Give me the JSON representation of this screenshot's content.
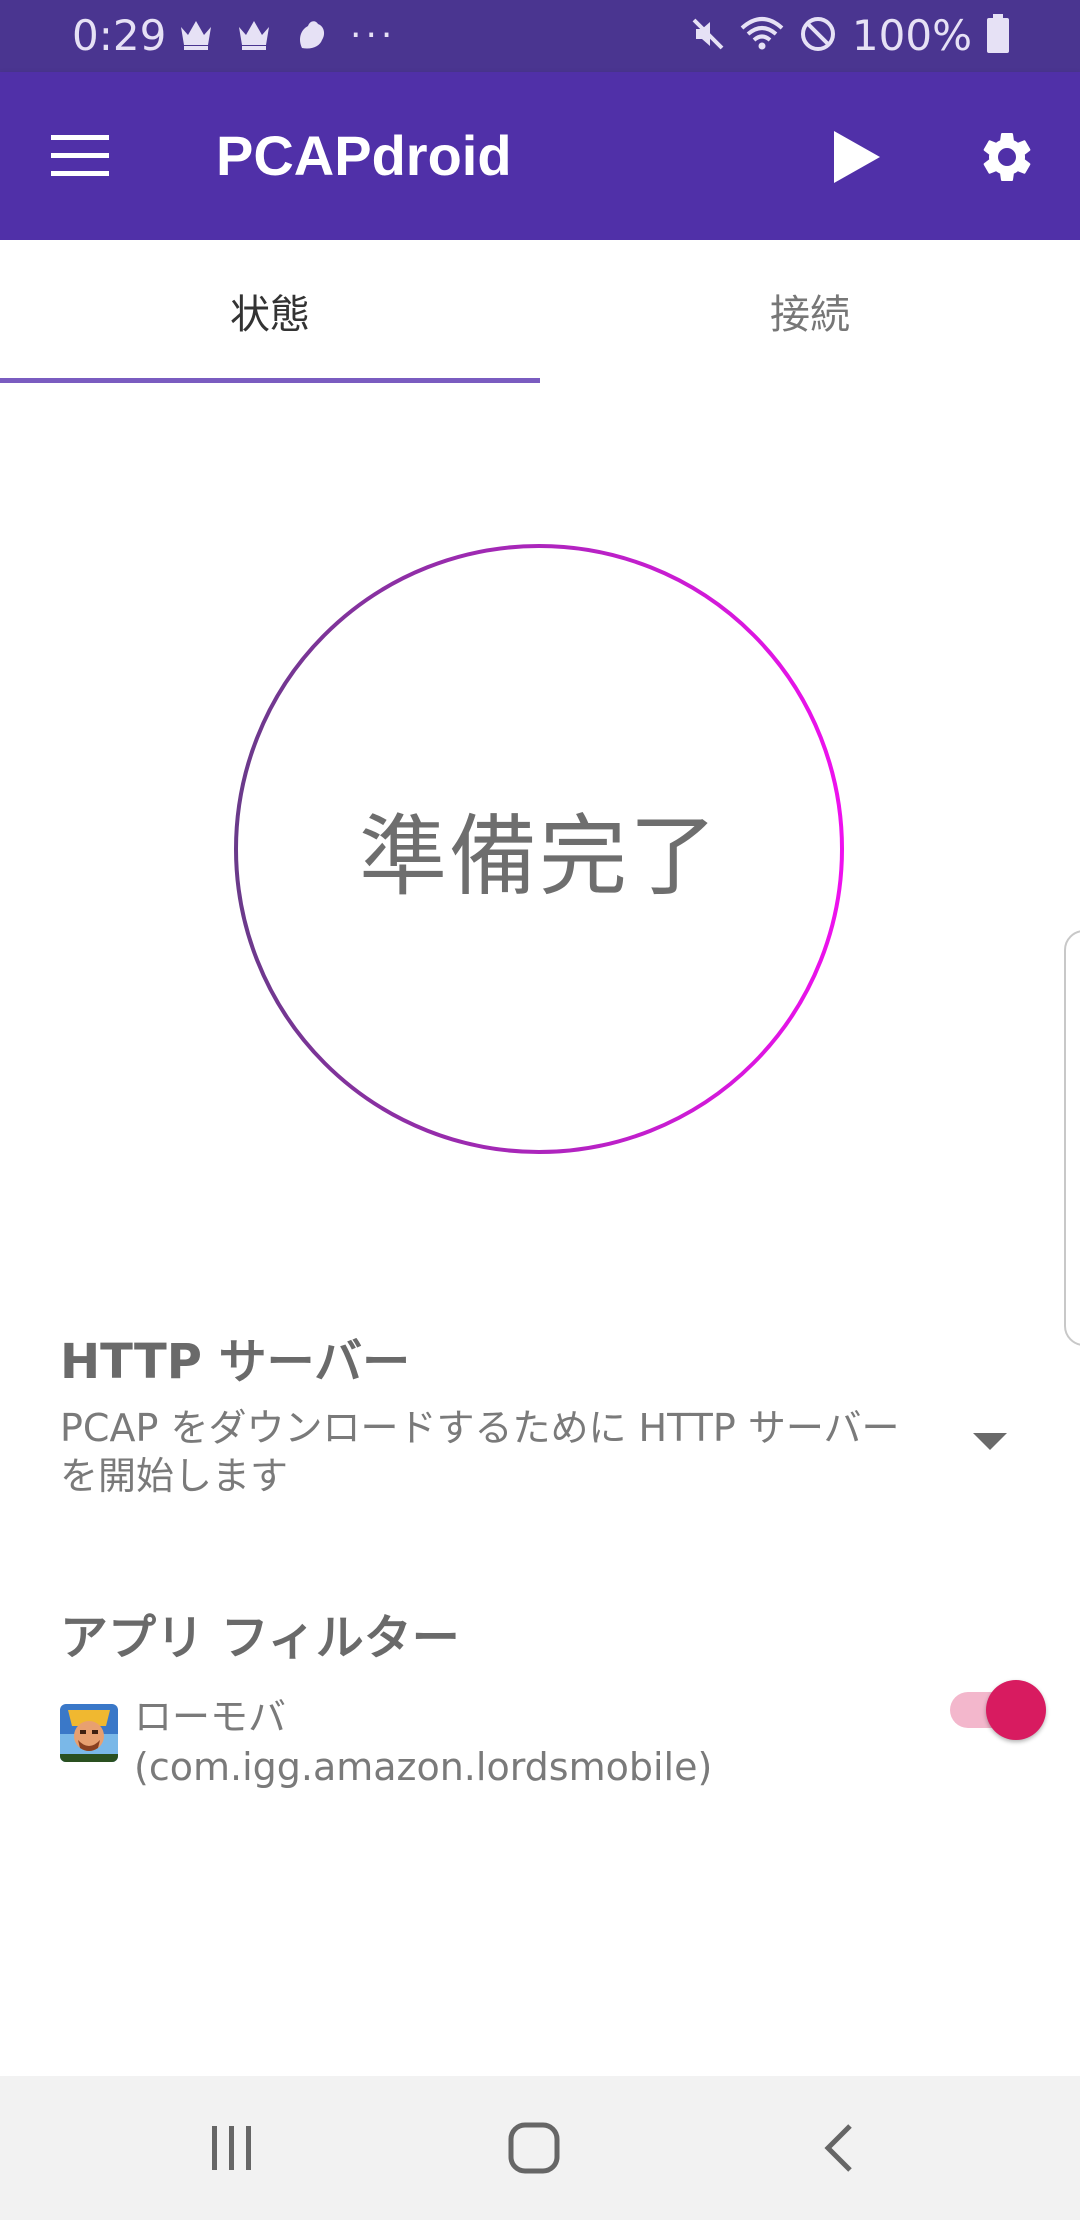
{
  "status_bar": {
    "time": "0:29",
    "overflow": "···",
    "battery": "100%",
    "icons_left": [
      "crown-icon",
      "crown-icon",
      "notification-app-icon"
    ],
    "icons_right": [
      "mute-icon",
      "wifi-icon",
      "do-not-disturb-icon",
      "battery-icon"
    ]
  },
  "app_bar": {
    "title": "PCAPdroid",
    "menu_icon": "hamburger-menu-icon",
    "play_icon": "play-icon",
    "settings_icon": "gear-icon",
    "background": "#5030a8"
  },
  "tabs": [
    {
      "label": "状態",
      "active": true
    },
    {
      "label": "接続",
      "active": false
    }
  ],
  "status": {
    "text": "準備完了",
    "ring_colors": [
      "#6a3a8a",
      "#ee11ee"
    ]
  },
  "http_server": {
    "title": "HTTP サーバー",
    "description": "PCAP をダウンロードするために HTTP サーバーを開始します"
  },
  "app_filter": {
    "title": "アプリ フィルター",
    "app_name": "ローモバ",
    "package": "(com.igg.amazon.lordsmobile)",
    "enabled": true,
    "toggle_color": "#d81b60"
  },
  "nav_bar": {
    "recents_icon": "recents-icon",
    "home_icon": "home-icon",
    "back_icon": "back-icon"
  }
}
